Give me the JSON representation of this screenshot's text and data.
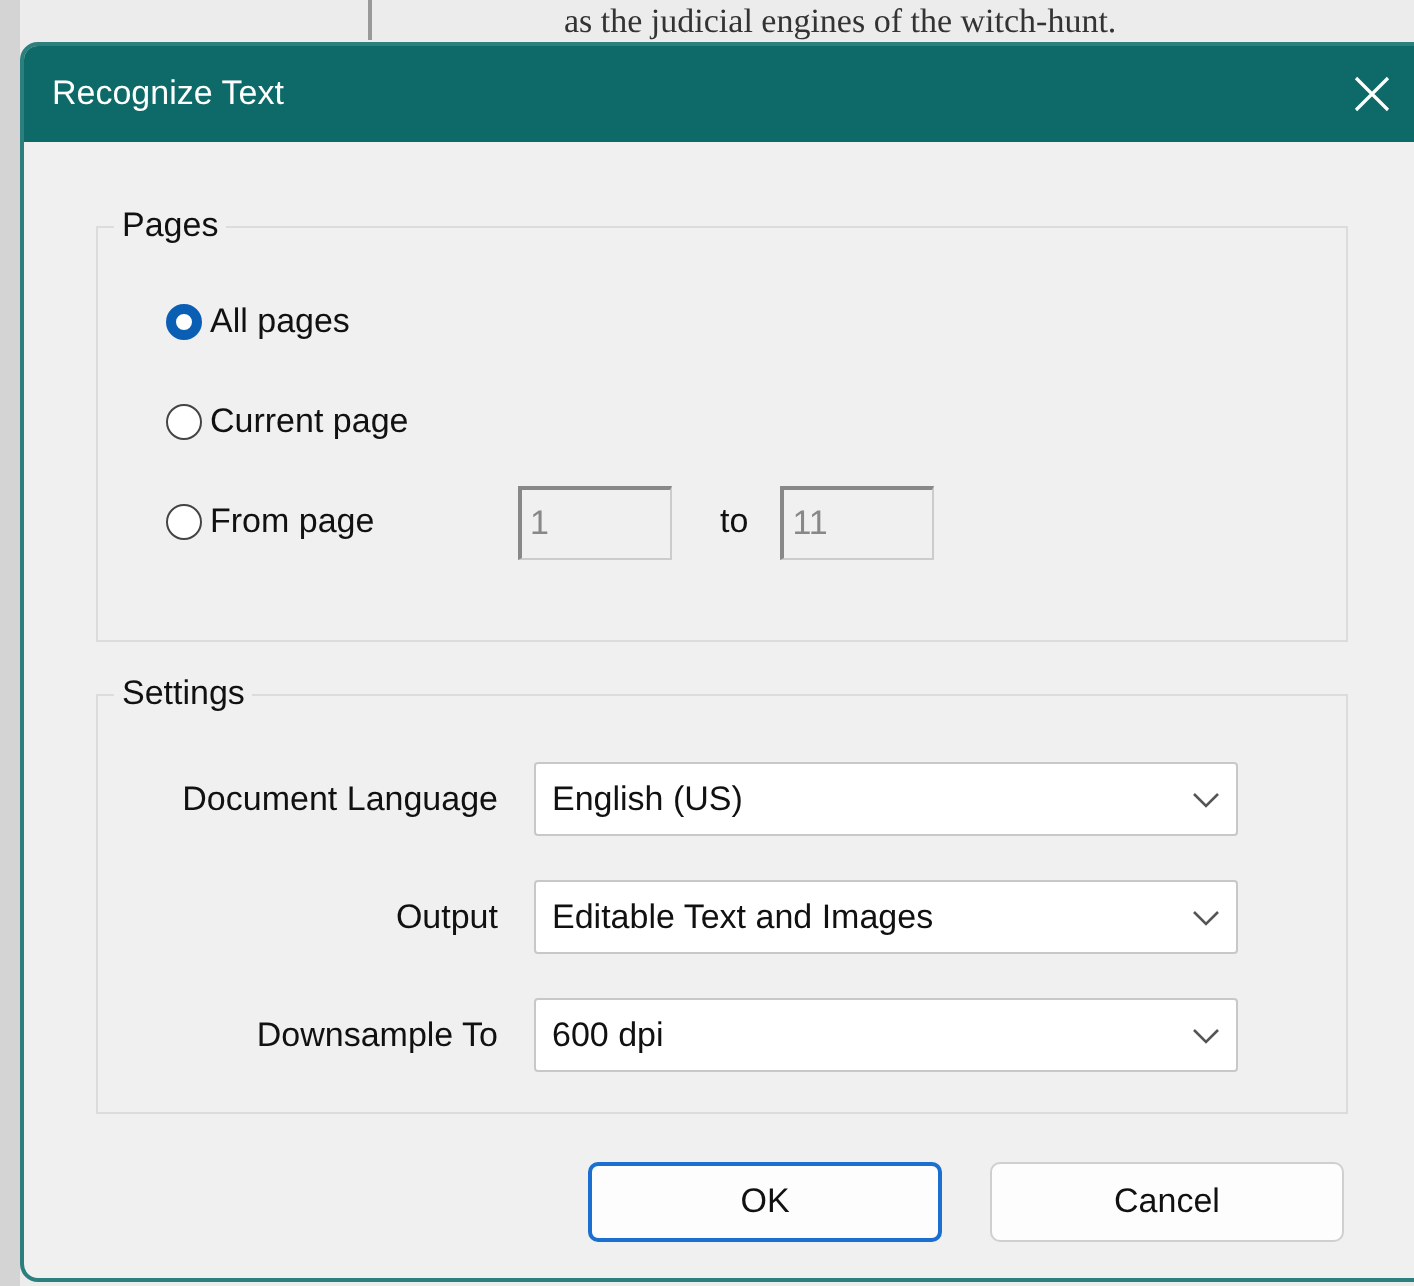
{
  "background": {
    "text": "as the judicial engines of the witch-hunt."
  },
  "dialog": {
    "title": "Recognize Text"
  },
  "pages": {
    "legend": "Pages",
    "options": [
      {
        "label": "All pages",
        "selected": true
      },
      {
        "label": "Current page",
        "selected": false
      },
      {
        "label": "From page",
        "selected": false
      }
    ],
    "range": {
      "from": "1",
      "to_label": "to",
      "to": "11",
      "disabled": true
    }
  },
  "settings": {
    "legend": "Settings",
    "fields": [
      {
        "label": "Document Language",
        "value": "English (US)"
      },
      {
        "label": "Output",
        "value": "Editable Text and Images"
      },
      {
        "label": "Downsample To",
        "value": "600 dpi"
      }
    ]
  },
  "buttons": [
    {
      "label": "OK",
      "default": true
    },
    {
      "label": "Cancel",
      "default": false
    }
  ]
}
